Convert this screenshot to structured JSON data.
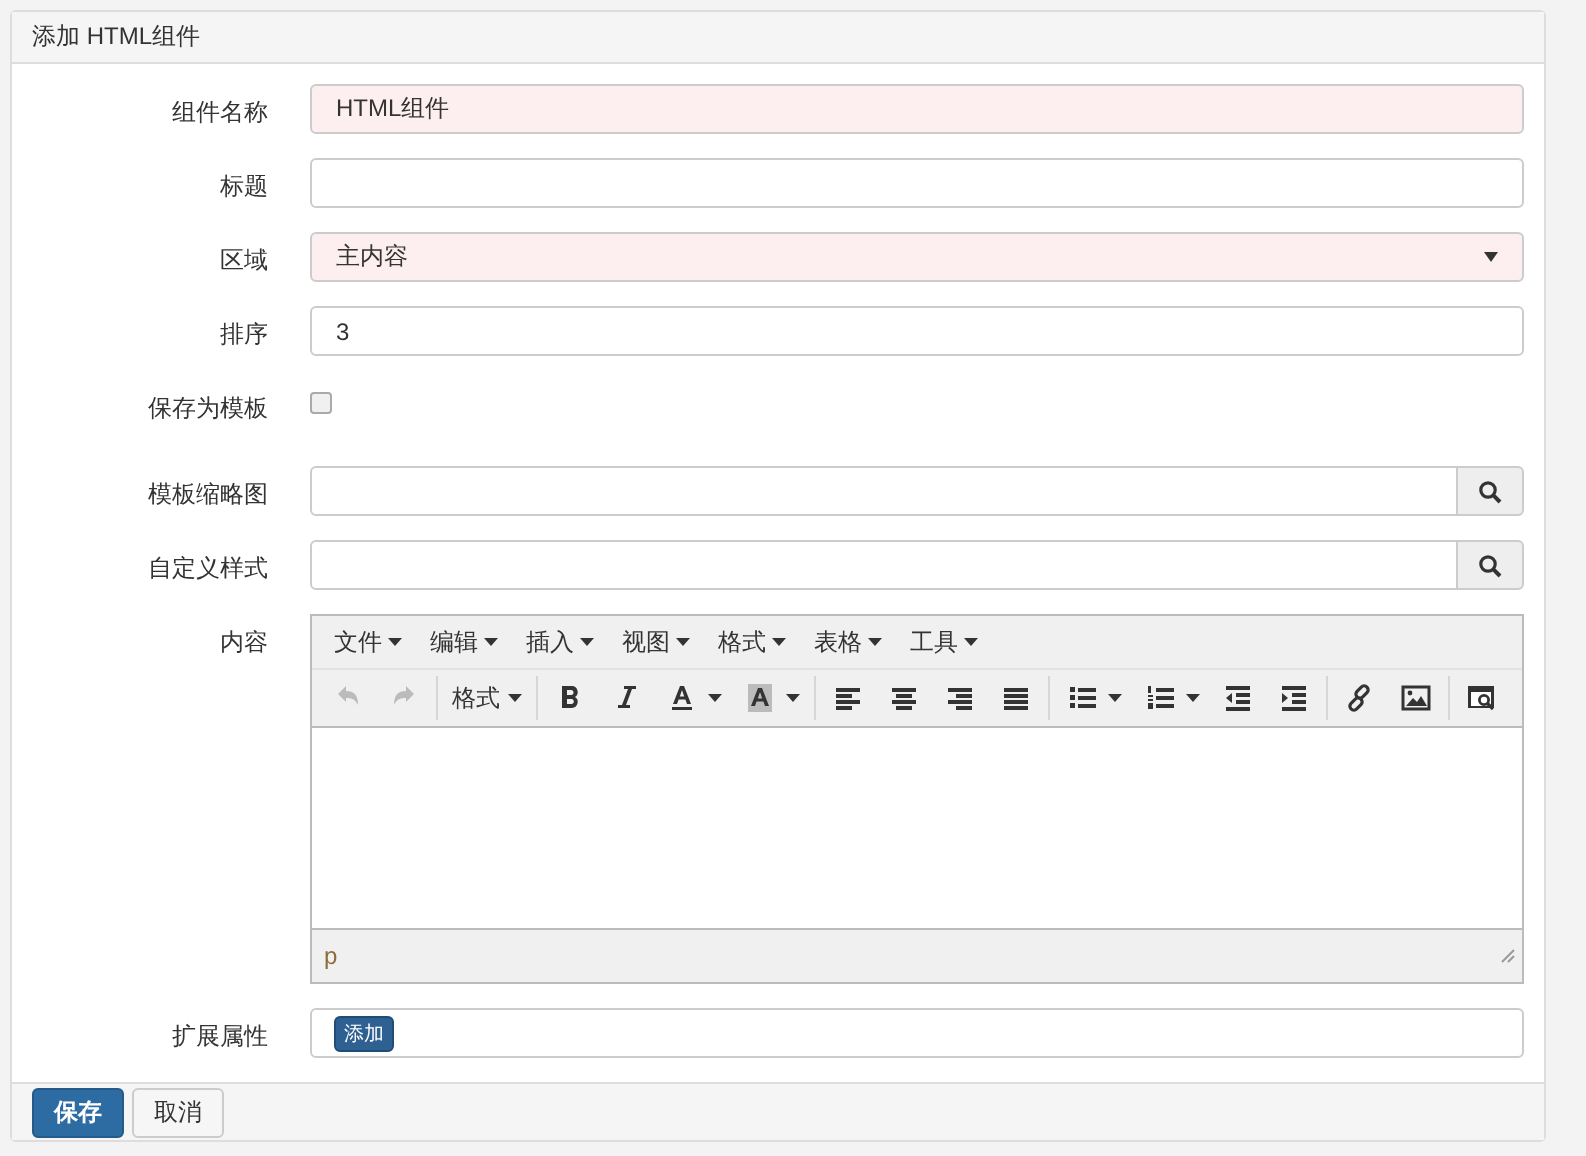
{
  "panel": {
    "title": "添加 HTML组件"
  },
  "fields": [
    {
      "kind": "text",
      "label": "组件名称",
      "value": "HTML组件",
      "highlighted": true
    },
    {
      "kind": "text",
      "label": "标题",
      "highlighted": false
    },
    {
      "kind": "select",
      "label": "区域",
      "value": "主内容",
      "highlighted": true
    },
    {
      "kind": "text",
      "label": "排序",
      "value": "3",
      "highlighted": false
    },
    {
      "kind": "checkbox",
      "label": "保存为模板",
      "checked": false
    },
    {
      "kind": "search",
      "label": "模板缩略图"
    },
    {
      "kind": "search",
      "label": "自定义样式"
    },
    {
      "kind": "editor",
      "label": "内容"
    },
    {
      "kind": "tags",
      "label": "扩展属性",
      "button": "添加"
    }
  ],
  "editor": {
    "menus": [
      "文件",
      "编辑",
      "插入",
      "视图",
      "格式",
      "表格",
      "工具"
    ],
    "toolbar": [
      {
        "kind": "undo",
        "disabled": true
      },
      {
        "kind": "redo",
        "disabled": true
      },
      {
        "kind": "separator"
      },
      {
        "kind": "dropdown",
        "label": "格式"
      },
      {
        "kind": "separator"
      },
      {
        "kind": "bold"
      },
      {
        "kind": "italic"
      },
      {
        "kind": "text-color"
      },
      {
        "kind": "bg-color"
      },
      {
        "kind": "separator"
      },
      {
        "kind": "align-left"
      },
      {
        "kind": "align-center"
      },
      {
        "kind": "align-right"
      },
      {
        "kind": "justify"
      },
      {
        "kind": "separator"
      },
      {
        "kind": "bullet-list"
      },
      {
        "kind": "number-list"
      },
      {
        "kind": "outdent"
      },
      {
        "kind": "indent"
      },
      {
        "kind": "separator"
      },
      {
        "kind": "link"
      },
      {
        "kind": "image"
      },
      {
        "kind": "separator"
      },
      {
        "kind": "preview"
      }
    ],
    "path": "p"
  },
  "buttons": [
    {
      "kind": "primary",
      "label": "保存"
    },
    {
      "kind": "default",
      "label": "取消"
    }
  ]
}
